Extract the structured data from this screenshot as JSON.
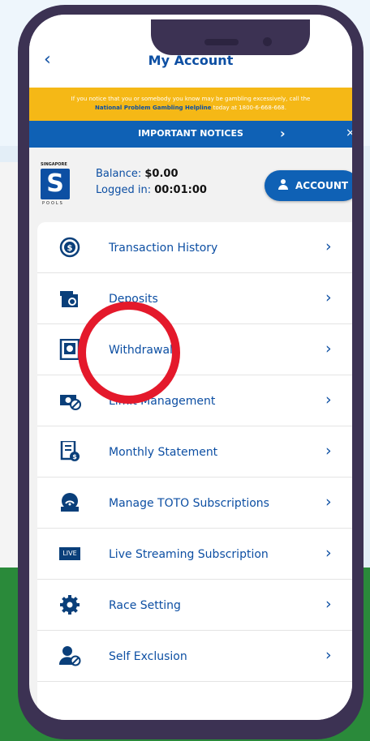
{
  "header": {
    "title": "My Account",
    "back_label": "‹"
  },
  "warning": {
    "line1": "If you notice that you or somebody you know may be gambling excessively, call the",
    "helpline": "National Problem Gambling Helpline",
    "line2_rest": " today at 1800-6-668-668."
  },
  "notices": {
    "label": "IMPORTANT NOTICES",
    "chevron": "›",
    "close": "×"
  },
  "account": {
    "logo_top": "SINGAPORE",
    "logo_letter": "S",
    "logo_bottom": "POOLS",
    "balance_label": "Balance:",
    "balance_value": "$0.00",
    "login_label": "Logged in:",
    "login_value": "00:01:00",
    "button_label": "ACCOUNT"
  },
  "menu": {
    "items": [
      {
        "label": "Transaction History",
        "icon": "dollar-refresh-icon"
      },
      {
        "label": "Deposits",
        "icon": "deposit-icon"
      },
      {
        "label": "Withdrawals",
        "icon": "withdrawal-icon"
      },
      {
        "label": "Limit Management",
        "icon": "limit-icon"
      },
      {
        "label": "Monthly Statement",
        "icon": "statement-icon"
      },
      {
        "label": "Manage TOTO Subscriptions",
        "icon": "toto-icon"
      },
      {
        "label": "Live Streaming Subscription",
        "icon": "live-icon"
      },
      {
        "label": "Race Setting",
        "icon": "gear-icon"
      },
      {
        "label": "Self Exclusion",
        "icon": "user-block-icon"
      }
    ],
    "chevron": "›",
    "live_badge": "LIVE"
  },
  "colors": {
    "brand_blue": "#0d4fa3",
    "warning": "#f5b816",
    "highlight": "#e4192b"
  }
}
